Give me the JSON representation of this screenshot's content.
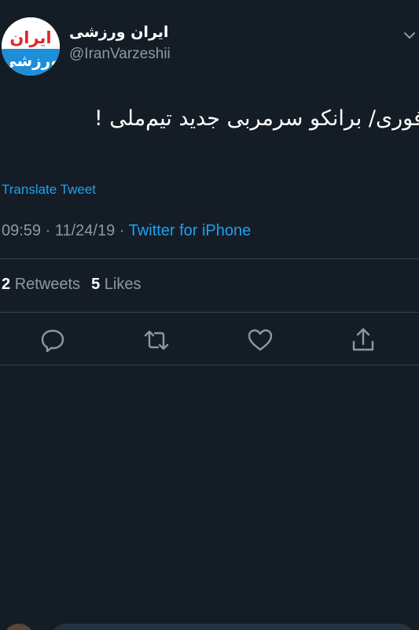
{
  "author": {
    "name": "ایران ورزشی",
    "handle": "@IranVarzeshii",
    "avatar_text_top": "ایران",
    "avatar_text_bottom": "ورزشی",
    "avatar_colors": {
      "red": "#e1262c",
      "blue": "#1c8fd8"
    }
  },
  "tweet": {
    "text": "فوری/ برانکو سرمربی جدید تیم‌ملی !",
    "translate_label": "Translate Tweet",
    "time": "09:59",
    "date": "11/24/19",
    "separator": " · ",
    "source": "Twitter for iPhone"
  },
  "stats": {
    "retweets_count": "2",
    "retweets_label": "Retweets",
    "likes_count": "5",
    "likes_label": "Likes"
  },
  "icons": {
    "chevron": "chevron-down-icon",
    "reply": "reply-icon",
    "retweet": "retweet-icon",
    "like": "heart-icon",
    "share": "share-icon"
  },
  "colors": {
    "background": "#141d26",
    "primary_text": "#ffffff",
    "secondary_text": "#8899a6",
    "accent": "#1da1f2",
    "divider": "#38444d"
  }
}
